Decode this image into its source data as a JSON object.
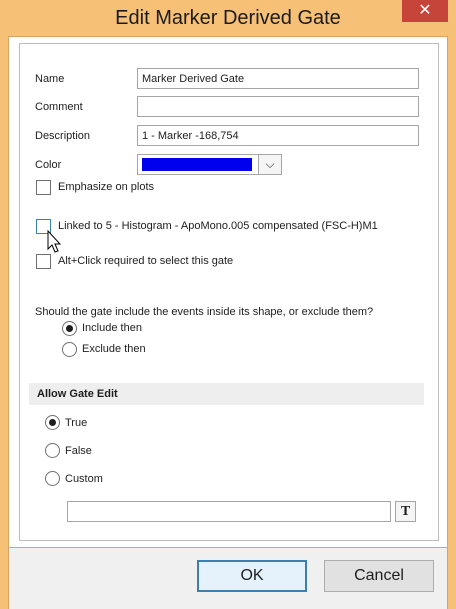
{
  "window": {
    "title": "Edit Marker Derived Gate",
    "close_glyph": "✕"
  },
  "form": {
    "name_label": "Name",
    "name_value": "Marker Derived Gate",
    "comment_label": "Comment",
    "comment_value": "",
    "description_label": "Description",
    "description_value": "1 - Marker -168,754",
    "color_label": "Color",
    "color_value": "#0000ee",
    "emphasize_label": "Emphasize on plots",
    "linked_label": "Linked to 5 - Histogram - ApoMono.005 compensated (FSC-H)M1",
    "altclick_label": "Alt+Click required to select this gate",
    "include_question": "Should the gate include the events inside its shape, or exclude them?",
    "include_label": "Include then",
    "exclude_label": "Exclude then"
  },
  "allow_edit": {
    "header": "Allow Gate Edit",
    "true_label": "True",
    "false_label": "False",
    "custom_label": "Custom",
    "custom_value": "",
    "text_button": "T"
  },
  "footer": {
    "ok_label": "OK",
    "cancel_label": "Cancel"
  }
}
